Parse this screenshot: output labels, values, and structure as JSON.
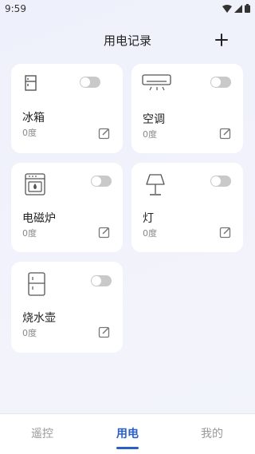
{
  "status": {
    "time": "9:59"
  },
  "header": {
    "title": "用电记录",
    "add_icon": "plus-icon"
  },
  "devices": [
    {
      "name": "冰箱",
      "usage": "0度",
      "icon": "fridge-icon",
      "on": false
    },
    {
      "name": "空调",
      "usage": "0度",
      "icon": "air-conditioner-icon",
      "on": false
    },
    {
      "name": "电磁炉",
      "usage": "0度",
      "icon": "induction-cooker-icon",
      "on": false
    },
    {
      "name": "灯",
      "usage": "0度",
      "icon": "lamp-icon",
      "on": false
    },
    {
      "name": "烧水壶",
      "usage": "0度",
      "icon": "kettle-icon",
      "on": false
    }
  ],
  "tabs": [
    {
      "label": "遥控",
      "active": false
    },
    {
      "label": "用电",
      "active": true
    },
    {
      "label": "我的",
      "active": false
    }
  ],
  "colors": {
    "accent": "#2b5fc7",
    "toggle_off": "#c9c9c9"
  }
}
